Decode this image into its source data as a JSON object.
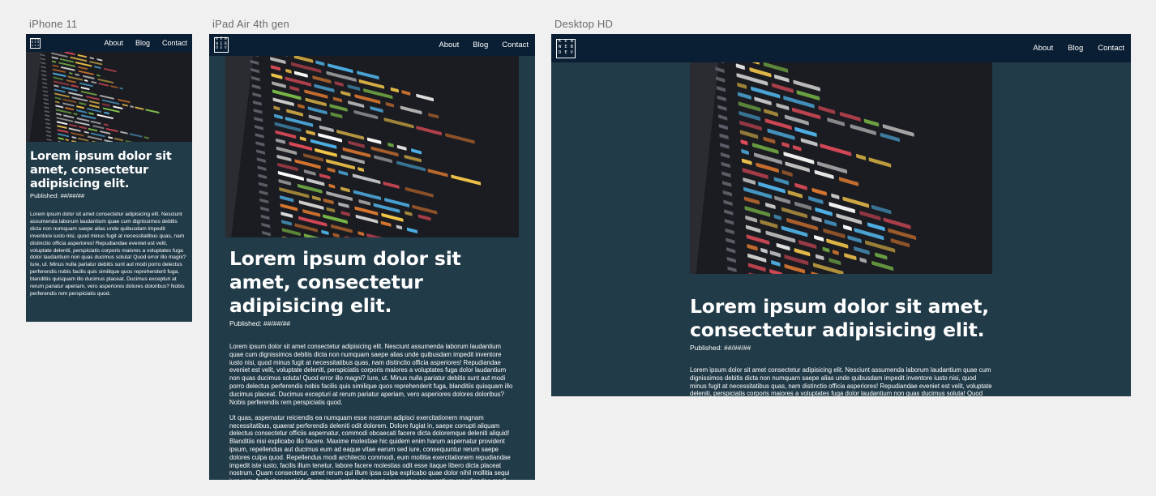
{
  "frames": [
    {
      "label": "iPhone 11"
    },
    {
      "label": "iPad Air 4th gen"
    },
    {
      "label": "Desktop HD"
    }
  ],
  "logo": {
    "letters": [
      "K",
      "E",
      "N",
      "W",
      "E",
      "B",
      "D",
      "E",
      "V"
    ]
  },
  "nav": {
    "about": "About",
    "blog": "Blog",
    "contact": "Contact"
  },
  "hero_icon": "code-screenshot-image",
  "article": {
    "title": "Lorem ipsum dolor sit amet, consectetur adipisicing elit.",
    "published": "Published: ##/##/##",
    "paragraphs": [
      "Lorem ipsum dolor sit amet consectetur adipisicing elit. Nesciunt assumenda laborum laudantium quae cum dignissimos debitis dicta non numquam saepe alias unde quibusdam impedit inventore iusto nisi, quod minus fugit at necessitatibus quas, nam distinctio officia asperiores! Repudiandae eveniet est velit, voluptate deleniti, perspiciatis corporis maiores a voluptates fuga dolor laudantium non quas ducimus soluta! Quod error illo magni? Iure, ut. Minus nulla pariatur debitis sunt aut modi porro delectus perferendis nobis facilis quis similique quos reprehenderit fuga, blanditiis quisquam illo ducimus placeat. Ducimus excepturi at rerum pariatur aperiam, vero asperiores dolores doloribus? Nobis perferendis rem perspiciatis quod.",
      "Ut quas, aspernatur reiciendis ea numquam esse nostrum adipisci exercitationem magnam necessitatibus, quaerat perferendis deleniti odit dolorem. Dolore fugiat in, saepe corrupti aliquam delectus consectetur officiis aspernatur, commodi obcaecati facere dicta doloremque deleniti aliquid! Blanditiis nisi explicabo illo facere. Maxime molestiae hic quidem enim harum aspernatur provident ipsum, repellendus aut ducimus eum ad eaque vitae earum sed iure, consequuntur rerum saepe dolores culpa quod. Repellendus modi architecto commodi, eum mollitia exercitationem repudiandae impedit iste iusto, facilis illum tenetur, labore facere molestias odit esse itaque libero dicta placeat nostrum. Quam consectetur, amet rerum qui illum ipsa culpa explicabo quae dolor nihil mollitia sequi iure rem, fugit obcaecati id. Quam in voluptate deserunt aspernatur accusantium repudiandae modi eligendi, laudantium obcaecati enim magni"
    ]
  },
  "colors": {
    "canvas": "#f0f0f0",
    "nav_bg": "#0b1f34",
    "content_bg": "#223b48",
    "text": "#ffffff"
  }
}
